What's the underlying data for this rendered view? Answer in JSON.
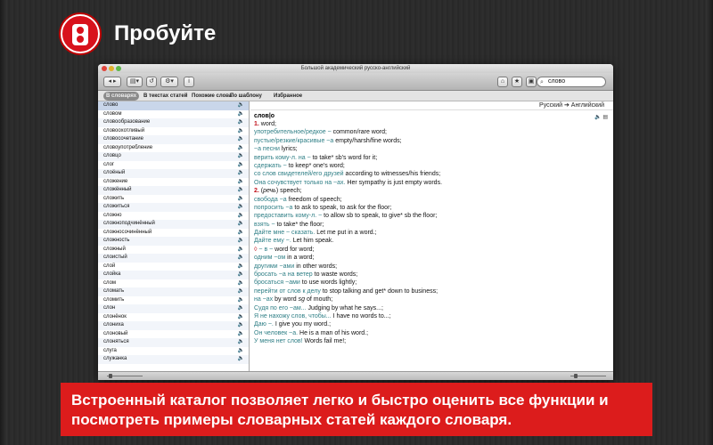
{
  "header": {
    "title": "Пробуйте",
    "icon": "app-logo-icon"
  },
  "window": {
    "title": "Большой академический русско-английский",
    "search_value": "слово",
    "tabs": [
      "В словарях",
      "В текстах статей",
      "Похожие слова",
      "По шаблону",
      "Избранное"
    ],
    "words": [
      "слово",
      "словом",
      "словообразование",
      "словоохотливый",
      "словосочетание",
      "словоупотребление",
      "словцо",
      "слог",
      "слоёный",
      "сложение",
      "сложённый",
      "сложить",
      "сложиться",
      "сложно",
      "сложноподчинённый",
      "сложносочинённый",
      "сложность",
      "сложный",
      "слоистый",
      "слой",
      "слойка",
      "слом",
      "сломать",
      "сломить",
      "слон",
      "слонёнок",
      "слониха",
      "слоновый",
      "слоняться",
      "слуга",
      "служанка"
    ],
    "direction": "Русский ➔ Английский",
    "headword": "слов|о",
    "entry_lines": [
      [
        {
          "t": "1.",
          "c": "num"
        },
        {
          "t": " word;"
        }
      ],
      [
        {
          "t": "употребительное/редкое ~ ",
          "c": "ru"
        },
        {
          "t": "common/rare word;"
        }
      ],
      [
        {
          "t": "пустые/резкие/красивые ~а ",
          "c": "ru"
        },
        {
          "t": "empty/harsh/fine words;"
        }
      ],
      [
        {
          "t": "~а песни ",
          "c": "ru"
        },
        {
          "t": "lyrics;"
        }
      ],
      [
        {
          "t": "верить кому-л. на ~ ",
          "c": "ru"
        },
        {
          "t": "to take* sb's word for it;"
        }
      ],
      [
        {
          "t": "сдержать ~ ",
          "c": "ru"
        },
        {
          "t": "to keep* one's word;"
        }
      ],
      [
        {
          "t": "со слов свидетелей/его друзей ",
          "c": "ru"
        },
        {
          "t": "according to witnesses/his friends;"
        }
      ],
      [
        {
          "t": "Она сочувствует только на ~ах. ",
          "c": "ru"
        },
        {
          "t": "Her sympathy is just empty words."
        }
      ],
      [
        {
          "t": "2.",
          "c": "num"
        },
        {
          "t": " ("
        },
        {
          "t": "речь",
          "c": "it"
        },
        {
          "t": ") speech;"
        }
      ],
      [
        {
          "t": "свобода ~а ",
          "c": "ru"
        },
        {
          "t": "freedom of speech;"
        }
      ],
      [
        {
          "t": "попросить ~а ",
          "c": "ru"
        },
        {
          "t": "to ask to speak, to ask for the floor;"
        }
      ],
      [
        {
          "t": "предоставить кому-л. ~ ",
          "c": "ru"
        },
        {
          "t": "to allow sb to speak, to give* sb the floor;"
        }
      ],
      [
        {
          "t": "взять ~ ",
          "c": "ru"
        },
        {
          "t": "to take* the floor;"
        }
      ],
      [
        {
          "t": "Дайте мне ~ сказать. ",
          "c": "ru"
        },
        {
          "t": "Let me put in a word.;"
        }
      ],
      [
        {
          "t": "Дайте ему ~. ",
          "c": "ru"
        },
        {
          "t": "Let him speak."
        }
      ],
      [
        {
          "t": "◊ ",
          "c": "red"
        },
        {
          "t": "~ в ~ ",
          "c": "ru"
        },
        {
          "t": "word for word;"
        }
      ],
      [
        {
          "t": "одним ~ом ",
          "c": "ru"
        },
        {
          "t": "in a word;"
        }
      ],
      [
        {
          "t": "другими ~ами ",
          "c": "ru"
        },
        {
          "t": "in other words;"
        }
      ],
      [
        {
          "t": "бросать ~а на ветер ",
          "c": "ru"
        },
        {
          "t": "to waste words;"
        }
      ],
      [
        {
          "t": "бросаться ~ами ",
          "c": "ru"
        },
        {
          "t": "to use words lightly;"
        }
      ],
      [
        {
          "t": "перейти от слов к делу ",
          "c": "ru"
        },
        {
          "t": "to stop talking and get* down to business;"
        }
      ],
      [
        {
          "t": "на ~ах ",
          "c": "ru"
        },
        {
          "t": "by word "
        },
        {
          "t": "sg",
          "c": "it"
        },
        {
          "t": " of mouth;"
        }
      ],
      [
        {
          "t": "Судя по его ~ам... ",
          "c": "ru"
        },
        {
          "t": "Judging by what he says...;"
        }
      ],
      [
        {
          "t": "Я не нахожу слов, чтобы... ",
          "c": "ru"
        },
        {
          "t": "I have no words to...;"
        }
      ],
      [
        {
          "t": "Даю ~. ",
          "c": "ru"
        },
        {
          "t": "I give you my word.;"
        }
      ],
      [
        {
          "t": "Он человек ~а. ",
          "c": "ru"
        },
        {
          "t": "He is a man of his word.;"
        }
      ],
      [
        {
          "t": "У меня нет слов! ",
          "c": "ru"
        },
        {
          "t": "Words fail me!;"
        }
      ]
    ]
  },
  "banner": {
    "text": "Встроенный каталог позволяет легко и быстро оценить все функции и посмотреть примеры словарных статей каждого словаря."
  },
  "colors": {
    "accent_red": "#dc1c1c",
    "ru_text": "#2f7f86"
  }
}
